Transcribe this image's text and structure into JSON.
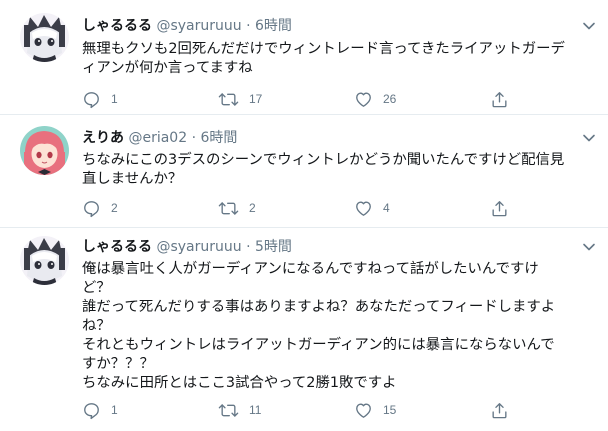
{
  "tweets": [
    {
      "name": "しゃるるる",
      "handle": "@syaruruuu",
      "dot": "·",
      "time": "6時間",
      "avatar": "anime-white-hair-girl",
      "lines": [
        "無理もクソも2回死んだだけでウィントレード言ってきたライアットガーデ",
        "ィアンが何か言ってますね"
      ],
      "reply_count": "1",
      "retweet_count": "17",
      "like_count": "26"
    },
    {
      "name": "えりあ",
      "handle": "@eria02",
      "dot": "·",
      "time": "6時間",
      "avatar": "anime-pink-hair-girl",
      "lines": [
        "ちなみにこの3デスのシーンでウィントレかどうか聞いたんですけど配信見",
        "直しませんか？"
      ],
      "reply_count": "2",
      "retweet_count": "2",
      "like_count": "4"
    },
    {
      "name": "しゃるるる",
      "handle": "@syaruruuu",
      "dot": "·",
      "time": "5時間",
      "avatar": "anime-white-hair-girl",
      "lines": [
        "俺は暴言吐く人がガーディアンになるんですねって話がしたいんですけ",
        "ど？",
        "誰だって死んだりする事はありますよね？あなただってフィードしますよ",
        "ね？",
        "それともウィントレはライアットガーディアン的には暴言にならないんで",
        "すか？？？",
        "ちなみに田所とはここ3試合やって2勝1敗ですよ"
      ],
      "reply_count": "1",
      "retweet_count": "11",
      "like_count": "15"
    }
  ],
  "colors": {
    "icon_gray": "#657786",
    "text": "#14171a",
    "divider": "#e6ecf0"
  },
  "icons": [
    "reply-icon",
    "retweet-icon",
    "like-icon",
    "share-icon",
    "chevron-down-icon"
  ]
}
